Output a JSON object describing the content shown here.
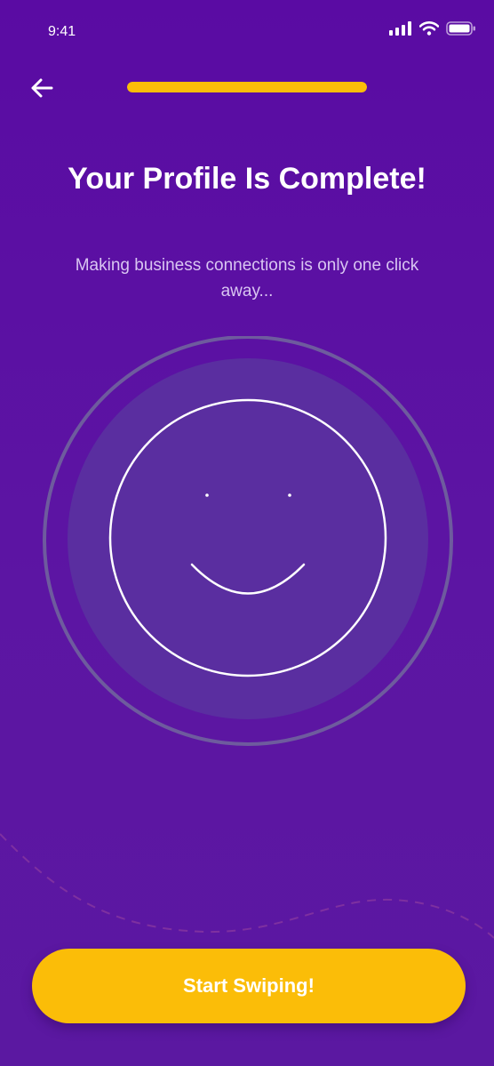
{
  "status_bar": {
    "time": "9:41"
  },
  "header": {
    "back_icon": "arrow-left-icon",
    "progress_fraction": 1.0
  },
  "main": {
    "title": "Your Profile Is Complete!",
    "subtitle": "Making business connections is only one click away...",
    "illustration_icon": "smiley-face-icon"
  },
  "footer": {
    "cta_label": "Start Swiping!"
  },
  "colors": {
    "background": "#5a0ba3",
    "accent": "#fbbd08",
    "subtitle_text": "#d9c6f2"
  }
}
